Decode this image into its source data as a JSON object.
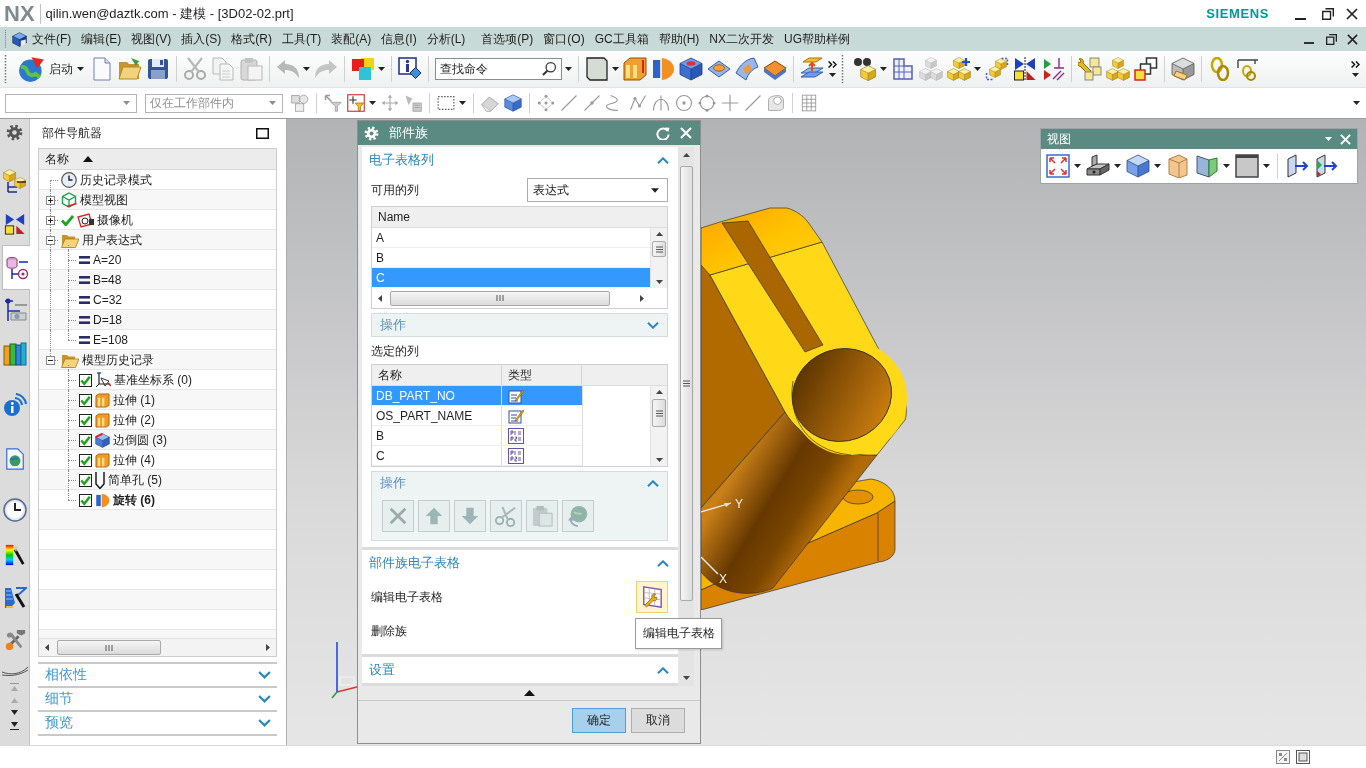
{
  "window": {
    "logo": "NX",
    "title": "qilin.wen@daztk.com - 建模 - [3D02-02.prt]",
    "brand": "SIEMENS"
  },
  "menu_bar": {
    "items": [
      "文件(F)",
      "编辑(E)",
      "视图(V)",
      "插入(S)",
      "格式(R)",
      "工具(T)",
      "装配(A)",
      "信息(I)",
      "分析(L)",
      "首选项(P)",
      "窗口(O)",
      "GC工具箱",
      "帮助(H)",
      "NX二次开发",
      "UG帮助样例"
    ]
  },
  "standard_toolbar": {
    "start_button": "启动",
    "command_search": {
      "placeholder": "查找命令"
    }
  },
  "selection_bar": {
    "type_filter": {
      "disabled": true
    },
    "scope_filter": {
      "value": "仅在工作部件内",
      "disabled": true
    }
  },
  "resource_bar": {
    "tabs": [
      {
        "selected": false
      },
      {
        "selected": false
      },
      {
        "selected": true
      },
      {
        "selected": false
      },
      {
        "selected": false
      },
      {
        "selected": false
      },
      {
        "selected": false
      },
      {
        "selected": false
      },
      {
        "selected": false
      },
      {
        "selected": false
      },
      {
        "selected": false
      }
    ]
  },
  "part_navigator": {
    "title": "部件导航器",
    "column": {
      "label": "名称",
      "sorted_ascending": true
    },
    "tree": [
      {
        "label": "历史记录模式",
        "kind": "mode"
      },
      {
        "label": "模型视图",
        "kind": "views",
        "expanded": false
      },
      {
        "label": "摄像机",
        "kind": "cameras",
        "expanded": false,
        "checked": true
      },
      {
        "label": "用户表达式",
        "kind": "folder",
        "expanded": true,
        "children": [
          {
            "label": "A=20",
            "kind": "expression"
          },
          {
            "label": "B=48",
            "kind": "expression"
          },
          {
            "label": "C=32",
            "kind": "expression"
          },
          {
            "label": "D=18",
            "kind": "expression"
          },
          {
            "label": "E=108",
            "kind": "expression"
          }
        ]
      },
      {
        "label": "模型历史记录",
        "kind": "folder",
        "expanded": true,
        "children": [
          {
            "label": "基准坐标系 (0)",
            "kind": "datum",
            "checked": true,
            "current": false
          },
          {
            "label": "拉伸 (1)",
            "kind": "extrude",
            "checked": true,
            "current": false
          },
          {
            "label": "拉伸 (2)",
            "kind": "extrude",
            "checked": true,
            "current": false
          },
          {
            "label": "边倒圆 (3)",
            "kind": "blend",
            "checked": true,
            "current": false
          },
          {
            "label": "拉伸 (4)",
            "kind": "extrude",
            "checked": true,
            "current": false
          },
          {
            "label": "简单孔 (5)",
            "kind": "hole",
            "checked": true,
            "current": false
          },
          {
            "label": "旋转 (6)",
            "kind": "revolve",
            "checked": true,
            "current": true
          }
        ]
      }
    ],
    "panels": [
      {
        "label": "相依性",
        "expanded": false
      },
      {
        "label": "细节",
        "expanded": false
      },
      {
        "label": "预览",
        "expanded": false
      }
    ]
  },
  "graphics": {
    "axis_labels": [
      "Y",
      "X"
    ]
  },
  "dialog": {
    "title": "部件族",
    "sections": [
      {
        "kind": "columns",
        "title": "电子表格列",
        "expanded": true,
        "available_label": "可用的列",
        "available_source": "表达式",
        "available_table": {
          "columns": [
            "Name"
          ],
          "rows": [
            {
              "label": "A",
              "selected": false
            },
            {
              "label": "B",
              "selected": false
            },
            {
              "label": "C",
              "selected": true
            }
          ]
        },
        "available_actions": {
          "title": "操作",
          "expanded": false
        },
        "chosen_label": "选定的列",
        "chosen_table": {
          "columns": [
            "名称",
            "类型"
          ],
          "rows": [
            {
              "name": "DB_PART_NO",
              "kind": "attribute",
              "selected": true
            },
            {
              "name": "OS_PART_NAME",
              "kind": "attribute",
              "selected": false
            },
            {
              "name": "B",
              "kind": "expression",
              "selected": false
            },
            {
              "name": "C",
              "kind": "expression",
              "selected": false
            }
          ]
        },
        "chosen_actions": {
          "title": "操作",
          "expanded": true,
          "tools": [
            {
              "disabled": true
            },
            {
              "disabled": true
            },
            {
              "disabled": true
            },
            {
              "disabled": true
            },
            {
              "disabled": true
            },
            {
              "disabled": true
            }
          ]
        }
      },
      {
        "kind": "spreadsheet",
        "title": "部件族电子表格",
        "expanded": true,
        "rows": [
          {
            "label": "编辑电子表格",
            "button": {
              "hovered": true
            }
          },
          {
            "label": "删除族"
          }
        ]
      },
      {
        "kind": "settings",
        "title": "设置",
        "expanded": true
      }
    ],
    "tooltip": "编辑电子表格",
    "buttons": [
      {
        "label": "确定",
        "default": true
      },
      {
        "label": "取消",
        "default": false
      }
    ]
  },
  "view_toolbar": {
    "title": "视图"
  }
}
